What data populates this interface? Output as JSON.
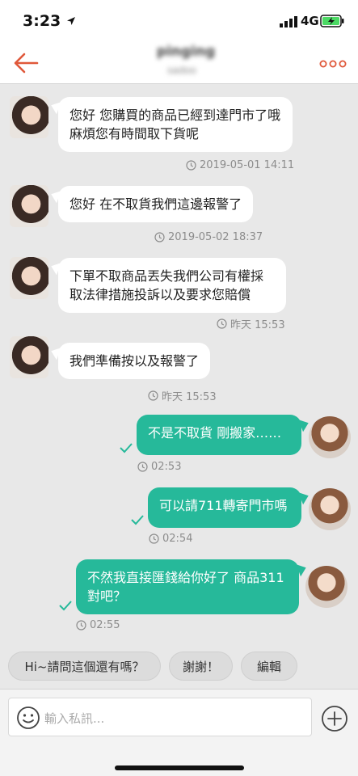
{
  "status": {
    "time": "3:23",
    "network": "4G"
  },
  "header": {
    "contact_name": "pinging",
    "contact_sub": "sadoo"
  },
  "messages": [
    {
      "text": "您好 您購買的商品已經到達門市了哦 麻煩您有時間取下貨呢",
      "time": "2019-05-01 14:11"
    },
    {
      "text": "您好 在不取貨我們這邊報警了",
      "time": "2019-05-02 18:37"
    },
    {
      "text": "下單不取商品丟失我們公司有權採取法律措施投訴以及要求您賠償",
      "time": "昨天 15:53"
    },
    {
      "text": "我們準備按以及報警了",
      "time": "昨天 15:53"
    },
    {
      "text": "不是不取貨 剛搬家……",
      "time": "02:53"
    },
    {
      "text": "可以請711轉寄門市嗎",
      "time": "02:54"
    },
    {
      "text": "不然我直接匯錢給你好了 商品311對吧？",
      "time": "02:55"
    }
  ],
  "quick_replies": [
    "Hi~請問這個還有嗎？",
    "謝謝！",
    "編輯"
  ],
  "input": {
    "placeholder": "輸入私訊..."
  },
  "colors": {
    "accent": "#e0583a",
    "outgoing_bubble": "#26b99a",
    "read_check": "#26b99a"
  }
}
